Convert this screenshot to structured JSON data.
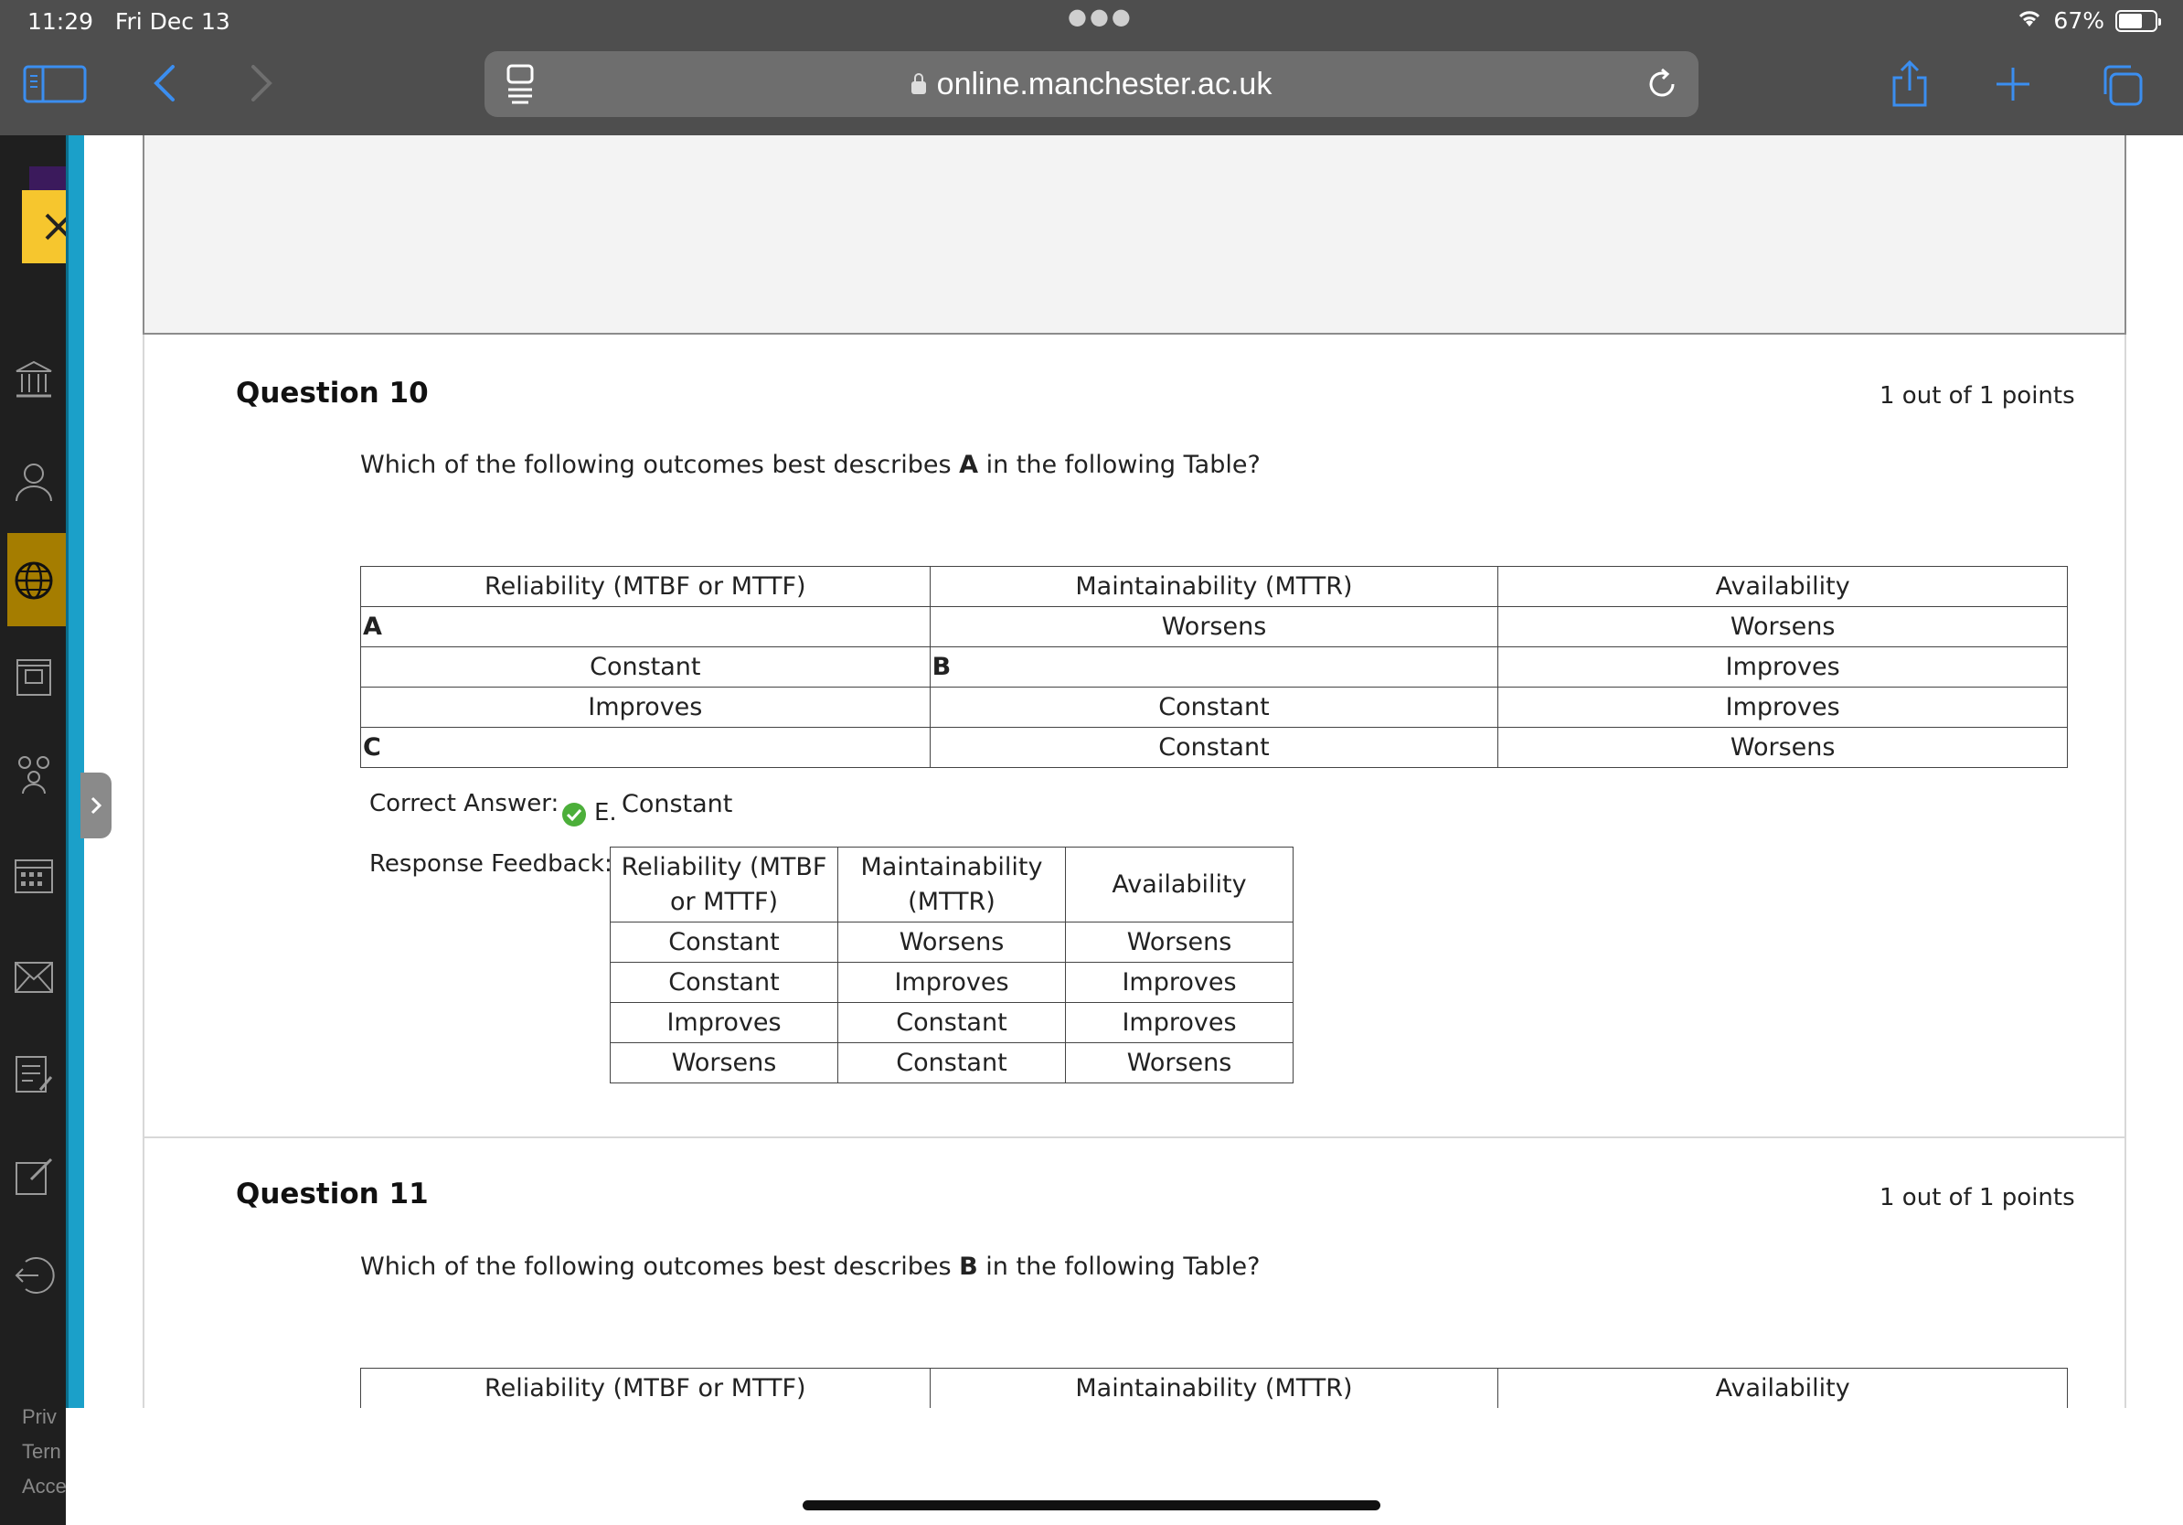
{
  "status_bar": {
    "time": "11:29",
    "date": "Fri Dec 13",
    "battery": "67%",
    "battery_level": 0.67
  },
  "browser": {
    "url": "online.manchester.ac.uk"
  },
  "sidebar": {
    "footer": [
      "Priv",
      "Tern",
      "Acce"
    ]
  },
  "question10": {
    "title": "Question 10",
    "points": "1 out of 1 points",
    "prompt_before": "Which of the following outcomes best describes ",
    "prompt_bold": "A",
    "prompt_after": " in the following Table?",
    "table": {
      "headers": [
        "Reliability (MTBF or MTTF)",
        "Maintainability (MTTR)",
        "Availability"
      ],
      "rows": [
        [
          "A",
          "Worsens",
          "Worsens"
        ],
        [
          "Constant",
          "B",
          "Improves"
        ],
        [
          "Improves",
          "Constant",
          "Improves"
        ],
        [
          "C",
          "Constant",
          "Worsens"
        ]
      ]
    },
    "correct_answer_label": "Correct Answer:",
    "correct_answer_letter": "E.",
    "correct_answer_value": "Constant",
    "feedback_label": "Response Feedback:",
    "feedback_table": {
      "headers": [
        "Reliability (MTBF or MTTF)",
        "Maintainability (MTTR)",
        "Availability"
      ],
      "rows": [
        [
          "Constant",
          "Worsens",
          "Worsens"
        ],
        [
          "Constant",
          "Improves",
          "Improves"
        ],
        [
          "Improves",
          "Constant",
          "Improves"
        ],
        [
          "Worsens",
          "Constant",
          "Worsens"
        ]
      ]
    }
  },
  "question11": {
    "title": "Question 11",
    "points": "1 out of 1 points",
    "prompt_before": "Which of the following outcomes best describes ",
    "prompt_bold": "B",
    "prompt_after": " in the following Table?",
    "table": {
      "headers": [
        "Reliability (MTBF or MTTF)",
        "Maintainability (MTTR)",
        "Availability"
      ]
    }
  }
}
